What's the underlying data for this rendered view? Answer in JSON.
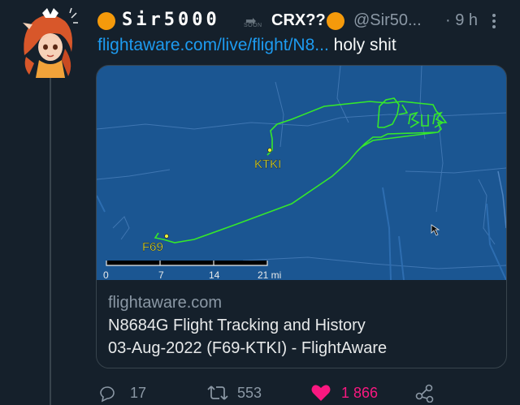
{
  "tweet": {
    "display_name_part1": "Sir5000",
    "soon_label": "SOON",
    "display_name_part2": "CRX??",
    "handle": "@Sir50...",
    "time": "· 9 h",
    "link_text": "flightaware.com/live/flight/N8...",
    "body_text": "holy shit",
    "accent_color": "#f59a0b",
    "link_color": "#1d9bf0"
  },
  "card": {
    "domain": "flightaware.com",
    "title_line1": "N8684G Flight Tracking and History",
    "title_line2": "03-Aug-2022 (F69-KTKI) - FlightAware",
    "map": {
      "airport_origin": "F69",
      "airport_dest": "KTKI",
      "sky_writing": "JSUS",
      "scale_labels": [
        "0",
        "7",
        "14",
        "21 mi"
      ],
      "route_color": "#35e82b",
      "water_color": "#1b5692"
    }
  },
  "actions": {
    "replies": "17",
    "retweets": "553",
    "likes": "1 866",
    "like_color": "#f91880"
  },
  "icons": [
    "avatar-anime-girl",
    "more-icon",
    "reply-icon",
    "retweet-icon",
    "heart-icon",
    "share-icon",
    "cursor-icon"
  ]
}
